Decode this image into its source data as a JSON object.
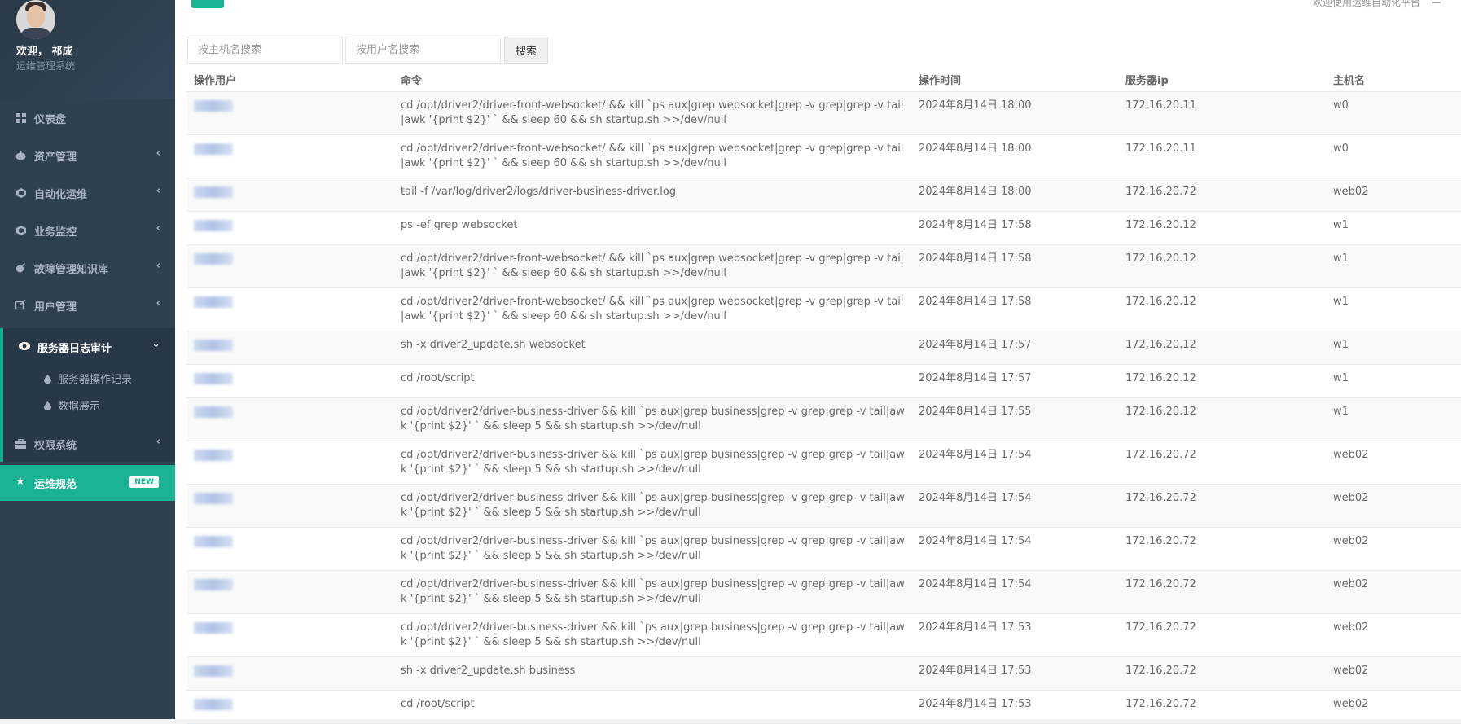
{
  "sidebar": {
    "welcome": "欢迎，  祁成",
    "subtitle": "运维管理系统",
    "items": [
      {
        "label": "仪表盘",
        "icon": "dashboard-icon",
        "has_children": false
      },
      {
        "label": "资产管理",
        "icon": "assets-icon",
        "has_children": true
      },
      {
        "label": "自动化运维",
        "icon": "automation-icon",
        "has_children": true
      },
      {
        "label": "业务监控",
        "icon": "monitor-icon",
        "has_children": true
      },
      {
        "label": "故障管理知识库",
        "icon": "bomb-icon",
        "has_children": true
      },
      {
        "label": "用户管理",
        "icon": "edit-icon",
        "has_children": true
      }
    ],
    "active_group": {
      "label": "服务器日志审计",
      "icon": "eye-icon",
      "children": [
        {
          "label": "服务器操作记录",
          "icon": "drop-icon"
        },
        {
          "label": "数据展示",
          "icon": "drop-icon"
        }
      ]
    },
    "after_items": [
      {
        "label": "权限系统",
        "icon": "briefcase-icon",
        "has_children": true
      }
    ],
    "highlight_item": {
      "label": "运维规范",
      "icon": "star-icon",
      "badge": "NEW"
    }
  },
  "header": {
    "right_text": "欢迎使用运维自动化平台"
  },
  "search": {
    "host_placeholder": "按主机名搜索",
    "user_placeholder": "按用户名搜索",
    "button_label": "搜索"
  },
  "table": {
    "headers": [
      "操作用户",
      "命令",
      "操作时间",
      "服务器ip",
      "主机名"
    ],
    "rows": [
      {
        "command": "cd /opt/driver2/driver-front-websocket/ && kill `ps aux|grep websocket|grep -v grep|grep -v tail|awk '{print $2}' ` && sleep 60 && sh startup.sh >>/dev/null",
        "time": "2024年8月14日 18:00",
        "ip": "172.16.20.11",
        "host": "w0"
      },
      {
        "command": "cd /opt/driver2/driver-front-websocket/ && kill `ps aux|grep websocket|grep -v grep|grep -v tail|awk '{print $2}' ` && sleep 60 && sh startup.sh >>/dev/null",
        "time": "2024年8月14日 18:00",
        "ip": "172.16.20.11",
        "host": "w0"
      },
      {
        "command": "tail -f /var/log/driver2/logs/driver-business-driver.log",
        "time": "2024年8月14日 18:00",
        "ip": "172.16.20.72",
        "host": "web02"
      },
      {
        "command": "ps -ef|grep websocket",
        "time": "2024年8月14日 17:58",
        "ip": "172.16.20.12",
        "host": "w1"
      },
      {
        "command": "cd /opt/driver2/driver-front-websocket/ && kill `ps aux|grep websocket|grep -v grep|grep -v tail|awk '{print $2}' ` && sleep 60 && sh startup.sh >>/dev/null",
        "time": "2024年8月14日 17:58",
        "ip": "172.16.20.12",
        "host": "w1"
      },
      {
        "command": "cd /opt/driver2/driver-front-websocket/ && kill `ps aux|grep websocket|grep -v grep|grep -v tail|awk '{print $2}' ` && sleep 60 && sh startup.sh >>/dev/null",
        "time": "2024年8月14日 17:58",
        "ip": "172.16.20.12",
        "host": "w1"
      },
      {
        "command": "sh -x driver2_update.sh websocket",
        "time": "2024年8月14日 17:57",
        "ip": "172.16.20.12",
        "host": "w1"
      },
      {
        "command": "cd /root/script",
        "time": "2024年8月14日 17:57",
        "ip": "172.16.20.12",
        "host": "w1"
      },
      {
        "command": "cd /opt/driver2/driver-business-driver && kill `ps aux|grep business|grep -v grep|grep -v tail|awk '{print $2}' ` && sleep 5 && sh startup.sh >>/dev/null",
        "time": "2024年8月14日 17:55",
        "ip": "172.16.20.12",
        "host": "w1"
      },
      {
        "command": "cd /opt/driver2/driver-business-driver && kill `ps aux|grep business|grep -v grep|grep -v tail|awk '{print $2}' ` && sleep 5 && sh startup.sh >>/dev/null",
        "time": "2024年8月14日 17:54",
        "ip": "172.16.20.72",
        "host": "web02"
      },
      {
        "command": "cd /opt/driver2/driver-business-driver && kill `ps aux|grep business|grep -v grep|grep -v tail|awk '{print $2}' ` && sleep 5 && sh startup.sh >>/dev/null",
        "time": "2024年8月14日 17:54",
        "ip": "172.16.20.72",
        "host": "web02"
      },
      {
        "command": "cd /opt/driver2/driver-business-driver && kill `ps aux|grep business|grep -v grep|grep -v tail|awk '{print $2}' ` && sleep 5 && sh startup.sh >>/dev/null",
        "time": "2024年8月14日 17:54",
        "ip": "172.16.20.72",
        "host": "web02"
      },
      {
        "command": "cd /opt/driver2/driver-business-driver && kill `ps aux|grep business|grep -v grep|grep -v tail|awk '{print $2}' ` && sleep 5 && sh startup.sh >>/dev/null",
        "time": "2024年8月14日 17:54",
        "ip": "172.16.20.72",
        "host": "web02"
      },
      {
        "command": "cd /opt/driver2/driver-business-driver && kill `ps aux|grep business|grep -v grep|grep -v tail|awk '{print $2}' ` && sleep 5 && sh startup.sh >>/dev/null",
        "time": "2024年8月14日 17:53",
        "ip": "172.16.20.72",
        "host": "web02"
      },
      {
        "command": "sh -x driver2_update.sh business",
        "time": "2024年8月14日 17:53",
        "ip": "172.16.20.72",
        "host": "web02"
      },
      {
        "command": "cd /root/script",
        "time": "2024年8月14日 17:53",
        "ip": "172.16.20.72",
        "host": "web02"
      }
    ]
  },
  "colors": {
    "sidebar_bg": "#2f4050",
    "accent": "#1ab394",
    "text": "#676a6c"
  }
}
